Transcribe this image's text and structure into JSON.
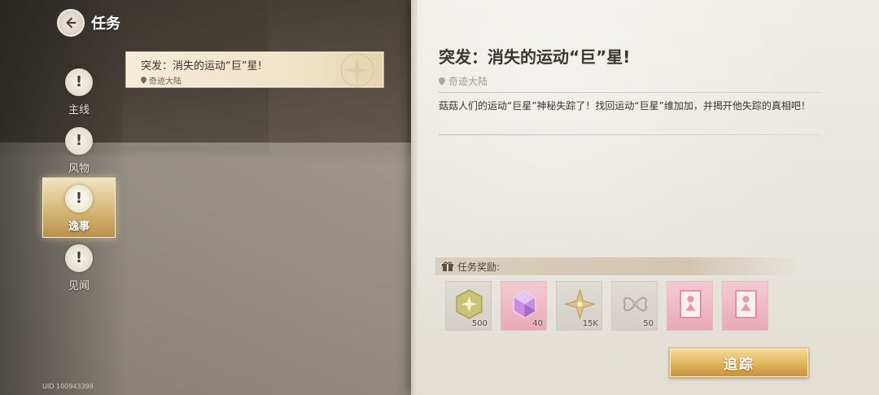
{
  "header": {
    "title": "任务",
    "back_icon": "back-arrow-icon"
  },
  "categories": [
    {
      "label": "主线",
      "icon": "exclamation-icon",
      "active": false
    },
    {
      "label": "风物",
      "icon": "exclamation-icon",
      "active": false
    },
    {
      "label": "逸事",
      "icon": "exclamation-icon",
      "active": true
    },
    {
      "label": "见闻",
      "icon": "exclamation-icon",
      "active": false
    }
  ],
  "quest_list": [
    {
      "title": "突发：消失的运动“巨”星!",
      "location": "奇迹大陆",
      "selected": true
    }
  ],
  "uid": "UID 100943399",
  "detail": {
    "title": "突发：消失的运动“巨”星!",
    "location": "奇迹大陆",
    "description": "菇菇人们的运动“巨星”神秘失踪了！找回运动“巨星”维加加，并揭开他失踪的真相吧！"
  },
  "rewards": {
    "label": "任务奖励:",
    "items": [
      {
        "icon": "star-badge-icon",
        "count": "500",
        "style": "gray"
      },
      {
        "icon": "pink-gem-icon",
        "count": "40",
        "style": "pink"
      },
      {
        "icon": "gold-star-icon",
        "count": "15K",
        "style": "gray"
      },
      {
        "icon": "ribbon-bow-icon",
        "count": "50",
        "style": "gray"
      },
      {
        "icon": "photo-card-icon",
        "count": "",
        "style": "pink"
      },
      {
        "icon": "photo-card-icon",
        "count": "",
        "style": "pink"
      }
    ]
  },
  "track_button": {
    "label": "追踪"
  },
  "colors": {
    "accent_gold": "#e0b45c",
    "panel_bg": "#ebe8e1",
    "text_dark": "#3c352e"
  }
}
